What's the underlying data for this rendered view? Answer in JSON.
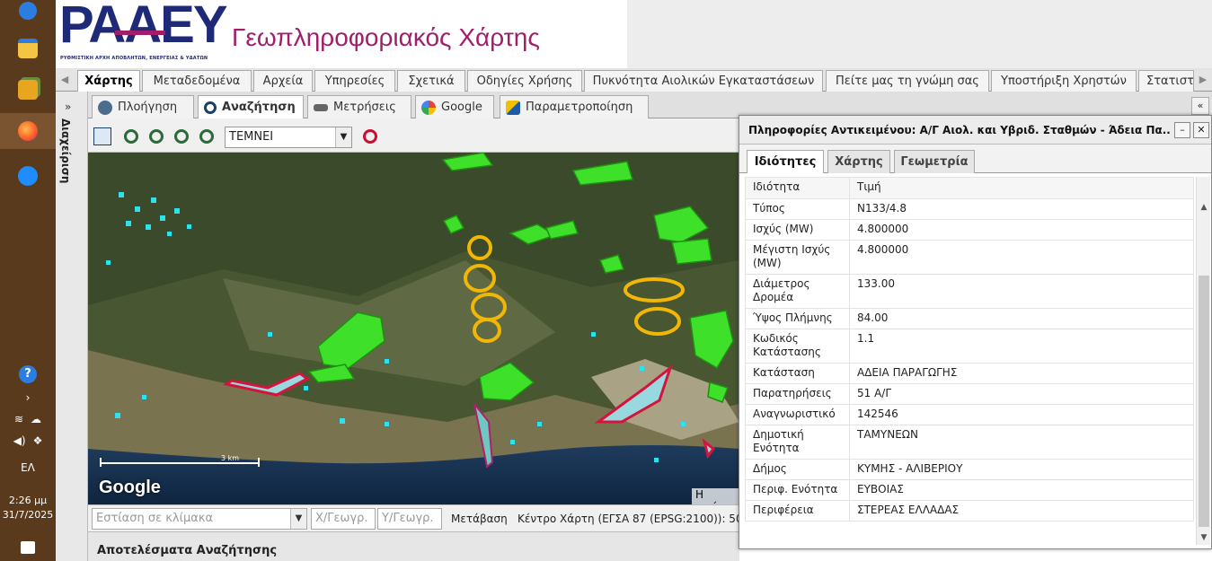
{
  "taskbar": {
    "language": "ΕΛ",
    "time": "2:26 μμ",
    "date": "31/7/2025"
  },
  "header": {
    "logo_text": "ΡΑΑΕΥ",
    "logo_subtitle": "ΡΥΘΜΙΣΤΙΚΗ ΑΡΧΗ ΑΠΟΒΛΗΤΩΝ, ΕΝΕΡΓΕΙΑΣ & ΥΔΑΤΩΝ",
    "title": "Γεωπληροφοριακός Χάρτης"
  },
  "main_tabs": [
    {
      "label": "Χάρτης",
      "active": true
    },
    {
      "label": "Μεταδεδομένα"
    },
    {
      "label": "Αρχεία"
    },
    {
      "label": "Υπηρεσίες"
    },
    {
      "label": "Σχετικά"
    },
    {
      "label": "Οδηγίες Χρήσης"
    },
    {
      "label": "Πυκνότητα Αιολικών Εγκαταστάσεων"
    },
    {
      "label": "Πείτε μας τη γνώμη σας"
    },
    {
      "label": "Υποστήριξη Χρηστών"
    },
    {
      "label": "Στατιστ"
    }
  ],
  "left_panel": {
    "label": "Διαχείριση"
  },
  "sub_tabs": [
    {
      "label": "Πλοήγηση"
    },
    {
      "label": "Αναζήτηση",
      "active": true
    },
    {
      "label": "Μετρήσεις"
    },
    {
      "label": "Google"
    },
    {
      "label": "Παραμετροποίηση"
    }
  ],
  "search": {
    "selected": "ΤΕΜΝΕΙ"
  },
  "map": {
    "attribution": "Google",
    "scale": "3 km",
    "credit": "Η εικόνα"
  },
  "bottom_bar": {
    "scale_placeholder": "Εστίαση σε κλίμακα",
    "x_placeholder": "Χ/Γεωγρ.",
    "y_placeholder": "Υ/Γεωγρ.",
    "goto_label": "Μετάβαση",
    "center_label": "Κέντρο Χάρτη (ΕΓΣΑ 87 (EPSG:2100)): 50"
  },
  "results": {
    "title": "Αποτελέσματα Αναζήτησης"
  },
  "info_window": {
    "title": "Πληροφορίες Αντικειμένου: Α/Γ Αιολ. και Υβριδ. Σταθμών - Άδεια Πα...",
    "tabs": [
      {
        "label": "Ιδιότητες",
        "active": true
      },
      {
        "label": "Χάρτης"
      },
      {
        "label": "Γεωμετρία"
      }
    ],
    "header_property": "Ιδιότητα",
    "header_value": "Τιμή",
    "rows": [
      {
        "property": "Τύπος",
        "value": "N133/4.8"
      },
      {
        "property": "Ισχύς (MW)",
        "value": "4.800000"
      },
      {
        "property": "Μέγιστη Ισχύς (MW)",
        "value": "4.800000"
      },
      {
        "property": "Διάμετρος Δρομέα",
        "value": "133.00"
      },
      {
        "property": "Ύψος Πλήμνης",
        "value": "84.00"
      },
      {
        "property": "Κωδικός Κατάστασης",
        "value": "1.1"
      },
      {
        "property": "Κατάσταση",
        "value": "ΑΔΕΙΑ ΠΑΡΑΓΩΓΗΣ"
      },
      {
        "property": "Παρατηρήσεις",
        "value": "51 Α/Γ"
      },
      {
        "property": "Αναγνωριστικό",
        "value": "142546"
      },
      {
        "property": "Δημοτική Ενότητα",
        "value": "ΤΑΜΥΝΕΩΝ"
      },
      {
        "property": "Δήμος",
        "value": "ΚΥΜΗΣ - ΑΛΙΒΕΡΙΟΥ"
      },
      {
        "property": "Περιφ. Ενότητα",
        "value": "ΕΥΒΟΙΑΣ"
      },
      {
        "property": "Περιφέρεια",
        "value": "ΣΤΕΡΕΑΣ ΕΛΛΑΔΑΣ"
      }
    ]
  },
  "colors": {
    "brand_blue": "#1e2a78",
    "brand_magenta": "#a11e6a",
    "wind_green": "#3ee02a",
    "wind_yellow": "#f2b705",
    "cyan_points": "#2fe0f0",
    "license_red": "#d4143c"
  }
}
